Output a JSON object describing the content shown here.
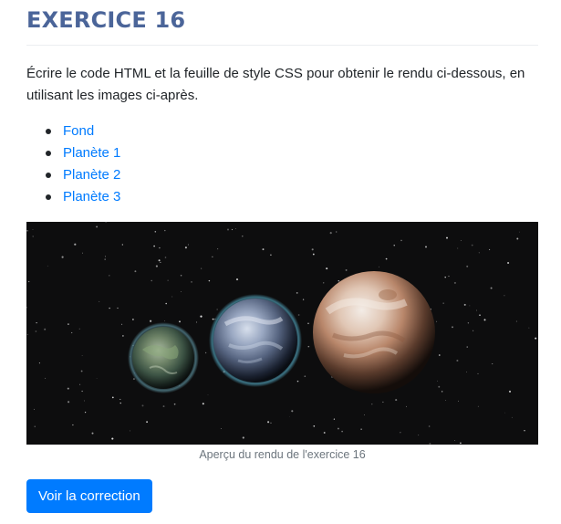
{
  "page": {
    "title": "EXERCICE 16",
    "intro": "Écrire le code HTML et la feuille de style CSS pour obtenir le rendu ci-dessous, en utilisant les images ci-après."
  },
  "resources": {
    "links": [
      {
        "label": "Fond"
      },
      {
        "label": "Planète 1"
      },
      {
        "label": "Planète 2"
      },
      {
        "label": "Planète 3"
      }
    ]
  },
  "preview": {
    "image_description_icons": [
      "starfield-background",
      "planet-small-green",
      "planet-medium-blue",
      "planet-large-tan"
    ],
    "caption": "Aperçu du rendu de l'exercice 16"
  },
  "actions": {
    "correction_label": "Voir la correction"
  },
  "colors": {
    "title": "#4b6599",
    "link": "#007bff",
    "button_bg": "#007bff",
    "caption": "#6c757d"
  }
}
